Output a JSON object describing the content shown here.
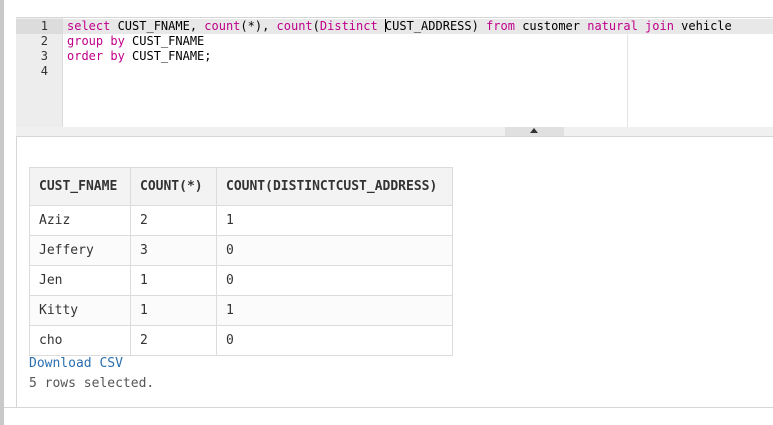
{
  "editor": {
    "line_numbers": [
      "1",
      "2",
      "3",
      "4"
    ],
    "lines": [
      [
        {
          "t": "select",
          "kw": true
        },
        {
          "t": " CUST_FNAME, ",
          "kw": false
        },
        {
          "t": "count",
          "kw": true
        },
        {
          "t": "(*), ",
          "kw": false
        },
        {
          "t": "count",
          "kw": true
        },
        {
          "t": "(",
          "kw": false
        },
        {
          "t": "Distinct",
          "kw": true
        },
        {
          "t": " ",
          "kw": false,
          "cursor_after": true
        },
        {
          "t": "CUST_ADDRESS) ",
          "kw": false
        },
        {
          "t": "from",
          "kw": true
        },
        {
          "t": " customer ",
          "kw": false
        },
        {
          "t": "natural",
          "kw": true
        },
        {
          "t": " ",
          "kw": false
        },
        {
          "t": "join",
          "kw": true
        },
        {
          "t": " vehicle",
          "kw": false
        }
      ],
      [
        {
          "t": "group by",
          "kw": true
        },
        {
          "t": " CUST_FNAME",
          "kw": false
        }
      ],
      [
        {
          "t": "order by",
          "kw": true
        },
        {
          "t": " CUST_FNAME;",
          "kw": false
        }
      ],
      []
    ]
  },
  "results": {
    "columns": [
      "CUST_FNAME",
      "COUNT(*)",
      "COUNT(DISTINCTCUST_ADDRESS)"
    ],
    "rows": [
      [
        "Aziz",
        "2",
        "1"
      ],
      [
        "Jeffery",
        "3",
        "0"
      ],
      [
        "Jen",
        "1",
        "0"
      ],
      [
        "Kitty",
        "1",
        "1"
      ],
      [
        "cho",
        "2",
        "0"
      ]
    ],
    "download_label": "Download CSV",
    "summary": "5 rows selected."
  },
  "colors": {
    "keyword": "#c0008a",
    "link": "#2a6fb0"
  }
}
